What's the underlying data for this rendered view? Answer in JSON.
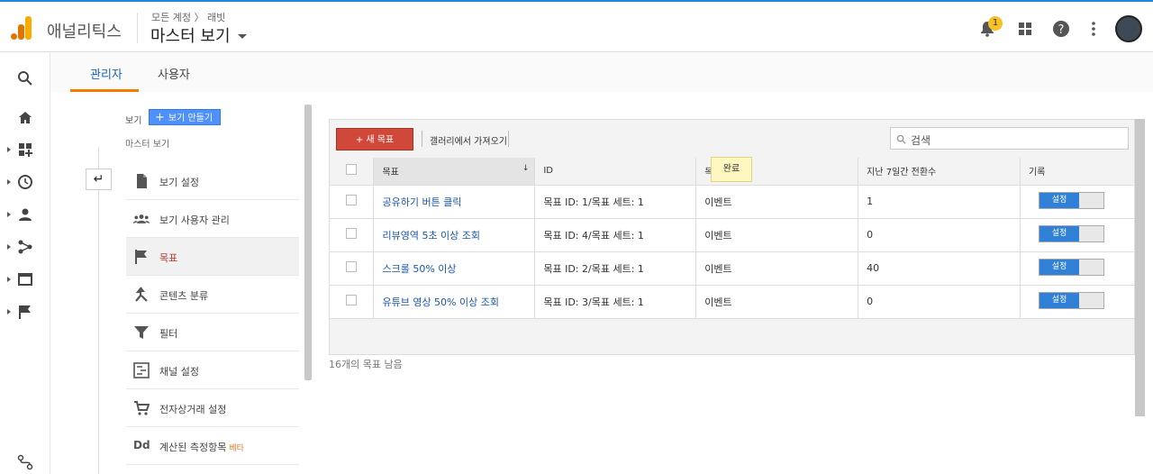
{
  "header": {
    "app_name": "애널리틱스",
    "breadcrumb": "모든 계정 〉 래빗",
    "view_name": "마스터 보기",
    "notification_count": "1"
  },
  "tabs": [
    {
      "label": "관리자"
    },
    {
      "label": "사용자"
    }
  ],
  "view_panel": {
    "section_label": "보기",
    "create_view_label": "보기 만들기",
    "selected_view": "마스터 보기",
    "back_symbol": "↵"
  },
  "menu": [
    {
      "label": "보기 설정",
      "icon": "document-icon"
    },
    {
      "label": "보기 사용자 관리",
      "icon": "users-icon"
    },
    {
      "label": "목표",
      "icon": "flag-icon"
    },
    {
      "label": "콘텐츠 분류",
      "icon": "grouping-icon"
    },
    {
      "label": "필터",
      "icon": "filter-icon"
    },
    {
      "label": "채널 설정",
      "icon": "channel-icon"
    },
    {
      "label": "전자상거래 설정",
      "icon": "cart-icon"
    },
    {
      "label": "계산된 측정항목",
      "beta": "베타",
      "icon": "dd-icon"
    }
  ],
  "goals": {
    "new_goal_label": "+ 새 목표",
    "import_label": "갤러리에서 가져오기",
    "search_placeholder": "검색",
    "tooltip": "완료",
    "columns": [
      "목표",
      "ID",
      "목",
      "지난 7일간 전환수",
      "기록"
    ],
    "rows": [
      {
        "name": "공유하기 버튼 클릭",
        "id": "목표 ID: 1/목표 세트: 1",
        "type": "이벤트",
        "conversions": "1",
        "record": "설정"
      },
      {
        "name": "리뷰영역 5초 이상 조회",
        "id": "목표 ID: 4/목표 세트: 1",
        "type": "이벤트",
        "conversions": "0",
        "record": "설정"
      },
      {
        "name": "스크롤 50% 이상",
        "id": "목표 ID: 2/목표 세트: 1",
        "type": "이벤트",
        "conversions": "40",
        "record": "설정"
      },
      {
        "name": "유튜브 영상 50% 이상 조회",
        "id": "목표 ID: 3/목표 세트: 1",
        "type": "이벤트",
        "conversions": "0",
        "record": "설정"
      }
    ],
    "remaining_text": "16개의 목표 남음"
  },
  "colors": {
    "accent": "#1e88e5",
    "tab_underline": "#f57c00",
    "new_goal": "#d0483a",
    "toggle_on": "#2f80d6"
  }
}
